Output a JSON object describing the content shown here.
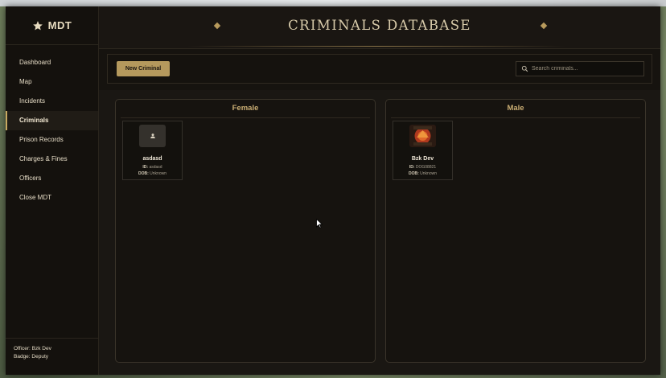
{
  "app": {
    "brand": "MDT"
  },
  "sidebar": {
    "items": [
      {
        "label": "Dashboard",
        "active": false
      },
      {
        "label": "Map",
        "active": false
      },
      {
        "label": "Incidents",
        "active": false
      },
      {
        "label": "Criminals",
        "active": true
      },
      {
        "label": "Prison Records",
        "active": false
      },
      {
        "label": "Charges & Fines",
        "active": false
      },
      {
        "label": "Officers",
        "active": false
      },
      {
        "label": "Close MDT",
        "active": false
      }
    ],
    "officer": {
      "name_line": "Officer: Bzk Dev",
      "badge_line": "Badge: Deputy"
    }
  },
  "header": {
    "title": "CRIMINALS DATABASE"
  },
  "toolbar": {
    "new_button": "New Criminal",
    "search_placeholder": "Search criminals..."
  },
  "groups": [
    {
      "title": "Female",
      "cards": [
        {
          "name": "asdasd",
          "id_label": "ID:",
          "id_value": "asdasd",
          "dob_label": "DOB:",
          "dob_value": "Unknown",
          "avatar": "user-icon"
        }
      ]
    },
    {
      "title": "Male",
      "cards": [
        {
          "name": "Bzk Dev",
          "id_label": "ID:",
          "id_value": "DOG08821",
          "dob_label": "DOB:",
          "dob_value": "Unknown",
          "avatar": "logo-image"
        }
      ]
    }
  ],
  "colors": {
    "accent": "#b5995d",
    "background": "#16130f",
    "text": "#e6dcc6"
  }
}
